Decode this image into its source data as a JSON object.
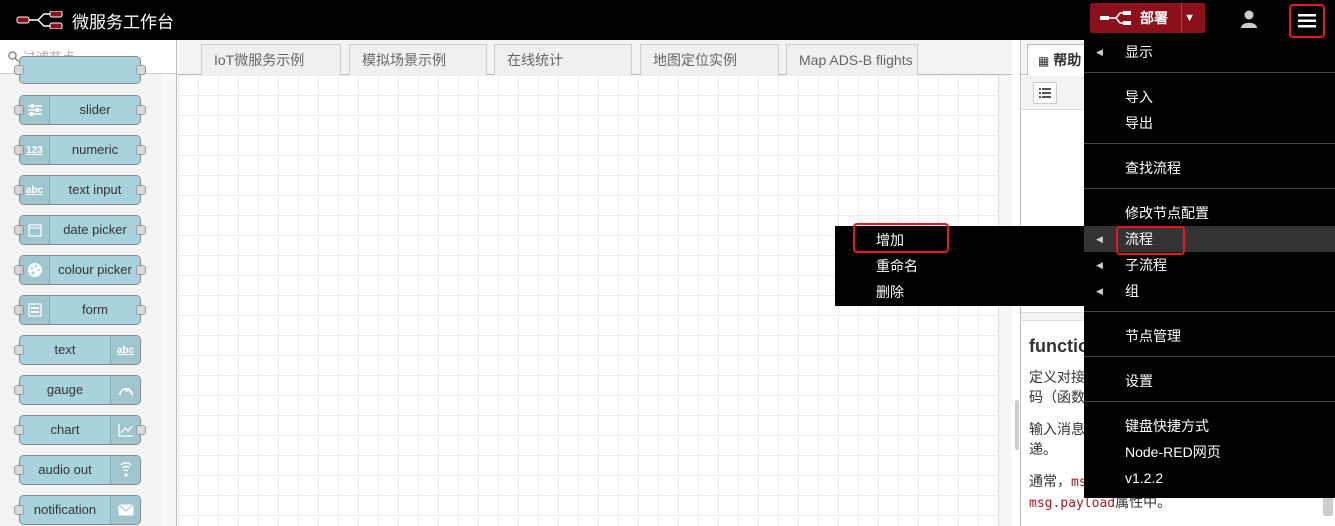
{
  "header": {
    "title": "微服务工作台",
    "deploy_label": "部署",
    "colors": {
      "background": "#000000",
      "deploy": "#8c101c",
      "highlight": "#e8181c"
    }
  },
  "palette": {
    "search_placeholder": "过滤节点",
    "nodes": [
      {
        "label": "slider",
        "icon": "slider-icon"
      },
      {
        "label": "numeric",
        "icon": "numeric-icon"
      },
      {
        "label": "text input",
        "icon": "text-input-icon"
      },
      {
        "label": "date picker",
        "icon": "calendar-icon"
      },
      {
        "label": "colour picker",
        "icon": "palette-icon"
      },
      {
        "label": "form",
        "icon": "form-icon"
      },
      {
        "label": "text",
        "icon": "text-icon"
      },
      {
        "label": "gauge",
        "icon": "gauge-icon"
      },
      {
        "label": "chart",
        "icon": "chart-icon"
      },
      {
        "label": "audio out",
        "icon": "audio-icon"
      },
      {
        "label": "notification",
        "icon": "envelope-icon"
      }
    ],
    "node_color": "#a9d3dc"
  },
  "workspace": {
    "tabs": [
      "IoT微服务示例",
      "模拟场景示例",
      "在线统计",
      "地图定位实例",
      "Map ADS-B flights"
    ]
  },
  "sidebar": {
    "help_tab_label": "帮助",
    "help_title": "functio",
    "help_lines": {
      "l1": "定义对接",
      "l2": "码（函数",
      "l3": "输入消息",
      "l4": "递。",
      "l5_prefix": "通常，",
      "l5_code": "ms",
      "l6_code": "msg.payload",
      "l6_suffix": "属性中。"
    }
  },
  "main_menu": {
    "items": {
      "display": "显示",
      "import": "导入",
      "export": "导出",
      "search_flows": "查找流程",
      "config_nodes": "修改节点配置",
      "flows": "流程",
      "subflows": "子流程",
      "groups": "组",
      "manage_palette": "节点管理",
      "settings": "设置",
      "keyboard": "键盘快捷方式",
      "node_red_website": "Node-RED网页",
      "version": "v1.2.2"
    }
  },
  "flows_submenu": {
    "add": "增加",
    "rename": "重命名",
    "delete": "删除"
  }
}
